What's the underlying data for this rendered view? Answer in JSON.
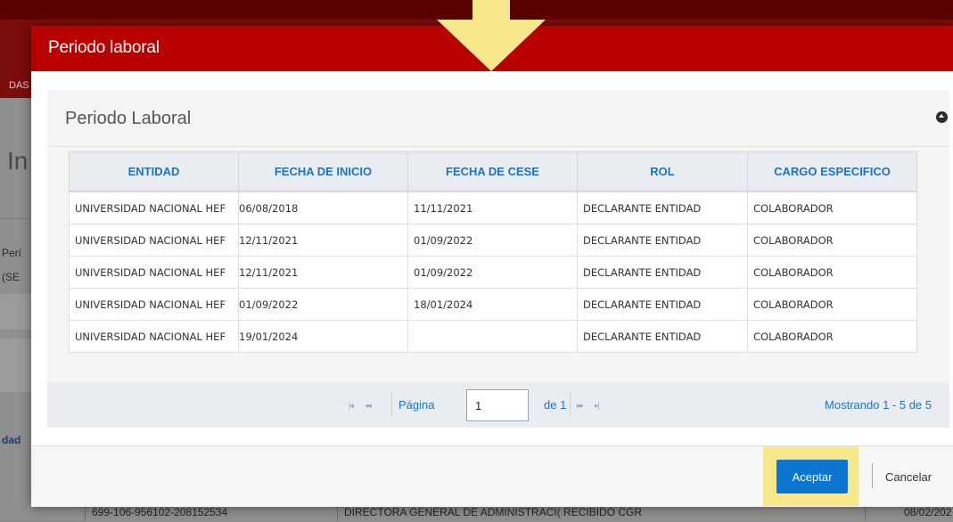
{
  "background": {
    "nav_fragment": "DAS",
    "heading_fragment": "In",
    "label_fragment_1": "Perí",
    "label_fragment_2": "(SE",
    "link_fragment": "dad",
    "footer_row": {
      "code": "699-106-956102-208152534",
      "description": "DIRECTORA GENERAL DE ADMINISTRACI( RECIBIDO CGR",
      "date": "08/02/202"
    }
  },
  "modal": {
    "title": "Periodo laboral",
    "panel_title": "Periodo Laboral",
    "table": {
      "columns": [
        "ENTIDAD",
        "FECHA DE INICIO",
        "FECHA DE CESE",
        "ROL",
        "CARGO ESPECIFICO"
      ],
      "rows": [
        [
          "UNIVERSIDAD NACIONAL HEF",
          "06/08/2018",
          "11/11/2021",
          "DECLARANTE ENTIDAD",
          "COLABORADOR"
        ],
        [
          "UNIVERSIDAD NACIONAL HEF",
          "12/11/2021",
          "01/09/2022",
          "DECLARANTE ENTIDAD",
          "COLABORADOR"
        ],
        [
          "UNIVERSIDAD NACIONAL HEF",
          "12/11/2021",
          "01/09/2022",
          "DECLARANTE ENTIDAD",
          "COLABORADOR"
        ],
        [
          "UNIVERSIDAD NACIONAL HEF",
          "01/09/2022",
          "18/01/2024",
          "DECLARANTE ENTIDAD",
          "COLABORADOR"
        ],
        [
          "UNIVERSIDAD NACIONAL HEF",
          "19/01/2024",
          "",
          "DECLARANTE ENTIDAD",
          "COLABORADOR"
        ]
      ]
    },
    "pager": {
      "page_label": "Página",
      "page_value": "1",
      "of_label": "de 1",
      "info": "Mostrando 1 - 5 de 5",
      "first_icon": "first-page-icon",
      "prev_icon": "prev-page-icon",
      "next_icon": "next-page-icon",
      "last_icon": "last-page-icon"
    },
    "footer": {
      "accept_label": "Aceptar",
      "cancel_label": "Cancelar"
    }
  },
  "colors": {
    "header_red": "#b80000",
    "accent_blue": "#1e73be",
    "button_blue": "#0b75d1",
    "highlight_yellow": "#f7e98b"
  }
}
